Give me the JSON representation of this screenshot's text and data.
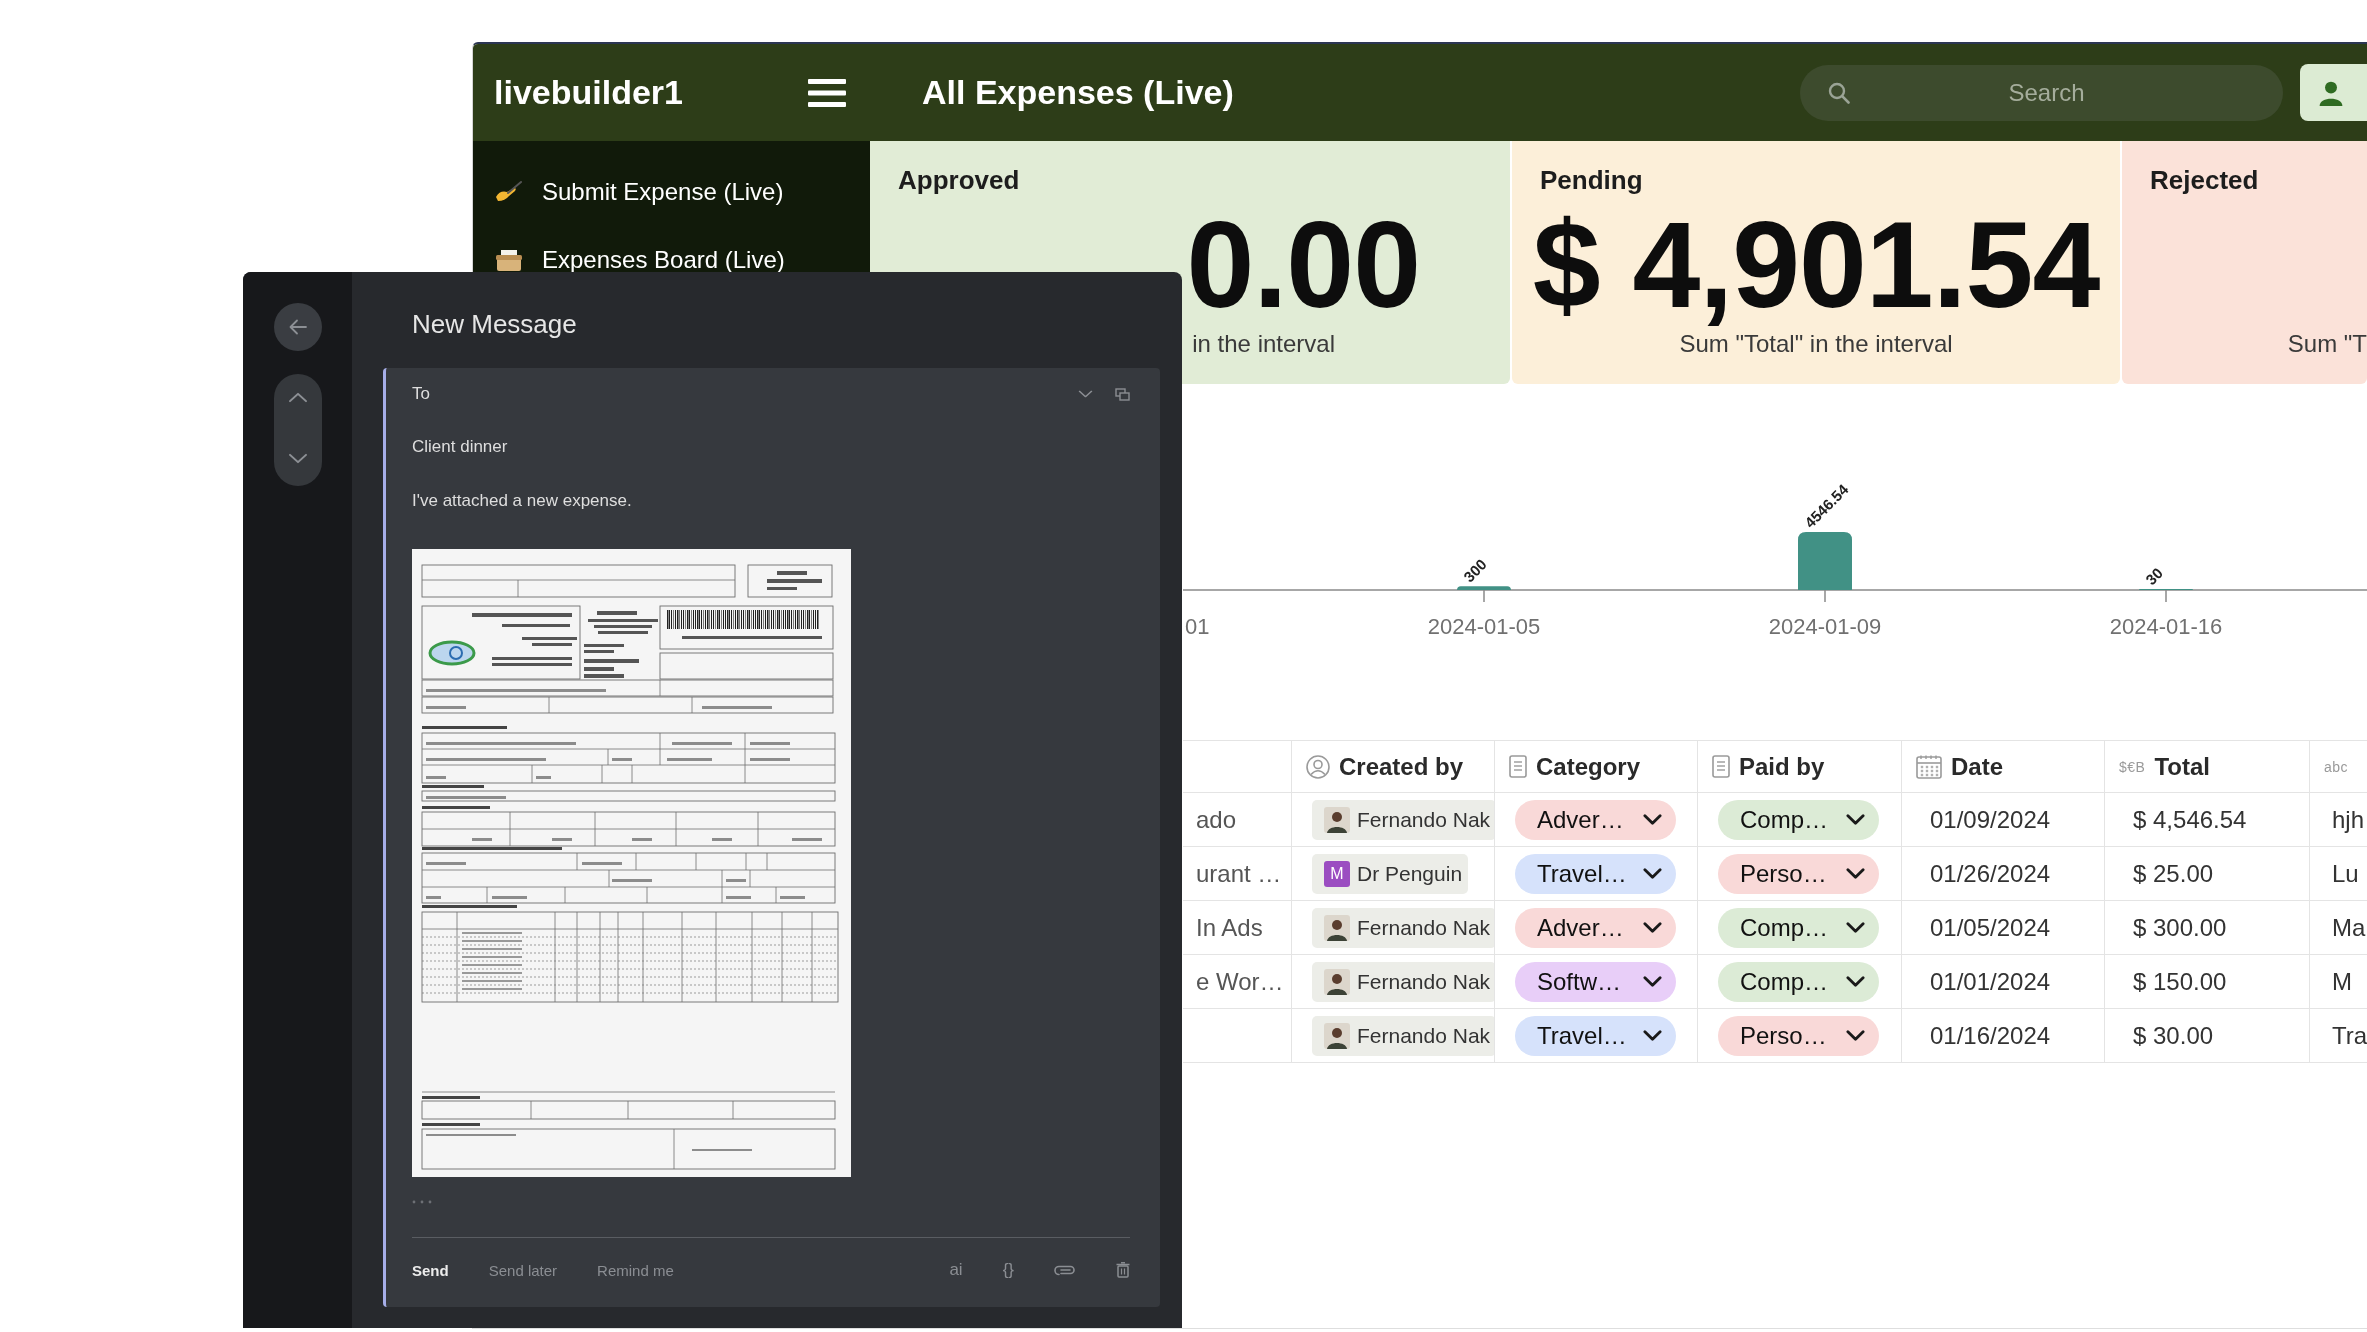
{
  "header": {
    "workspace": "livebuilder1",
    "title": "All Expenses (Live)",
    "search": {
      "placeholder": "Search"
    }
  },
  "sidebar": {
    "items": [
      {
        "label": "Submit Expense (Live)",
        "kind": "form",
        "selected": false
      },
      {
        "label": "Expenses Board (Live)",
        "kind": "board",
        "selected": false
      }
    ]
  },
  "kpis": [
    {
      "label": "Approved",
      "value": "0.00",
      "caption": "in the interval",
      "color": "#e1ecd6"
    },
    {
      "label": "Pending",
      "value": "$ 4,901.54",
      "caption": "Sum \"Total\" in the interval",
      "color": "#fcefd9"
    },
    {
      "label": "Rejected",
      "caption": "Sum \"T",
      "color": "#fbe2d9"
    }
  ],
  "chart": {
    "chart_data": {
      "type": "bar",
      "categories": [
        "01",
        "2024-01-05",
        "2024-01-09",
        "2024-01-16"
      ],
      "values": [
        null,
        300,
        4546.54,
        30
      ],
      "data_labels": true
    }
  },
  "table": {
    "columns": [
      {
        "kind": "text"
      },
      {
        "label": "Created by",
        "kind": "person"
      },
      {
        "label": "Category",
        "kind": "select"
      },
      {
        "label": "Paid by",
        "kind": "select"
      },
      {
        "label": "Date",
        "kind": "date"
      },
      {
        "label": "Total",
        "kind": "currency",
        "type_label": "$€B"
      },
      {
        "kind": "text",
        "type_label": "abc"
      }
    ],
    "rows": [
      {
        "column_1": "ado",
        "created_by": {
          "name": "Fernando Nak",
          "kind": "photo"
        },
        "category": {
          "label": "Adver…",
          "color": "#f9d9d8"
        },
        "paid_by": {
          "label": "Comp…",
          "color": "#dcebd6"
        },
        "date": "01/09/2024",
        "total": "$ 4,546.54",
        "column_7": "hjh"
      },
      {
        "column_1": "urant …",
        "created_by": {
          "name": "Dr Penguin",
          "kind": "initial",
          "initial": "M",
          "color": "#9b4dc1"
        },
        "category": {
          "label": "Travel…",
          "color": "#d6e2fb"
        },
        "paid_by": {
          "label": "Perso…",
          "color": "#f9d9d8"
        },
        "date": "01/26/2024",
        "total": "$ 25.00",
        "column_7": "Lu"
      },
      {
        "column_1": "In Ads",
        "created_by": {
          "name": "Fernando Nak",
          "kind": "photo"
        },
        "category": {
          "label": "Adver…",
          "color": "#f9d9d8"
        },
        "paid_by": {
          "label": "Comp…",
          "color": "#dcebd6"
        },
        "date": "01/05/2024",
        "total": "$ 300.00",
        "column_7": "Ma"
      },
      {
        "column_1": "e Wor…",
        "created_by": {
          "name": "Fernando Nak",
          "kind": "photo"
        },
        "category": {
          "label": "Softw…",
          "color": "#e8cef8"
        },
        "paid_by": {
          "label": "Comp…",
          "color": "#dcebd6"
        },
        "date": "01/01/2024",
        "total": "$ 150.00",
        "column_7": "M"
      },
      {
        "created_by": {
          "name": "Fernando Nak",
          "kind": "photo"
        },
        "category": {
          "label": "Travel…",
          "color": "#d6e2fb"
        },
        "paid_by": {
          "label": "Perso…",
          "color": "#f9d9d8"
        },
        "date": "01/16/2024",
        "total": "$ 30.00",
        "column_7": "Tra"
      }
    ]
  },
  "compose": {
    "title": "New Message",
    "to": {
      "placeholder": "To"
    },
    "subject": {
      "value": "Client dinner"
    },
    "body": "I've attached a new expense.",
    "actions": [
      {
        "label": "Send",
        "kind": "primary"
      },
      {
        "label": "Send later",
        "kind": "secondary"
      },
      {
        "label": "Remind me",
        "kind": "secondary"
      }
    ],
    "tools": [
      {
        "kind": "text",
        "label": "ai"
      },
      {
        "kind": "text",
        "label": "{}"
      },
      {
        "kind": "attach"
      },
      {
        "kind": "delete"
      }
    ]
  }
}
